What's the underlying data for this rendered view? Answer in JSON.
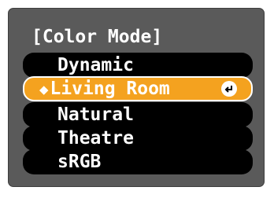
{
  "menu": {
    "title": "[Color Mode]",
    "items": [
      {
        "label": "Dynamic",
        "selected": false
      },
      {
        "label": "Living Room",
        "selected": true
      },
      {
        "label": "Natural",
        "selected": false
      },
      {
        "label": "Theatre",
        "selected": false
      },
      {
        "label": "sRGB",
        "selected": false
      }
    ],
    "cursor_glyph": "◆",
    "icons": {
      "cursor": "up-down-diamond-icon",
      "enter": "enter-return-icon"
    }
  },
  "colors": {
    "panel": "#5a5a5a",
    "item_background": "#000000",
    "selected_background": "#f4a21f",
    "text": "#ffffff"
  }
}
